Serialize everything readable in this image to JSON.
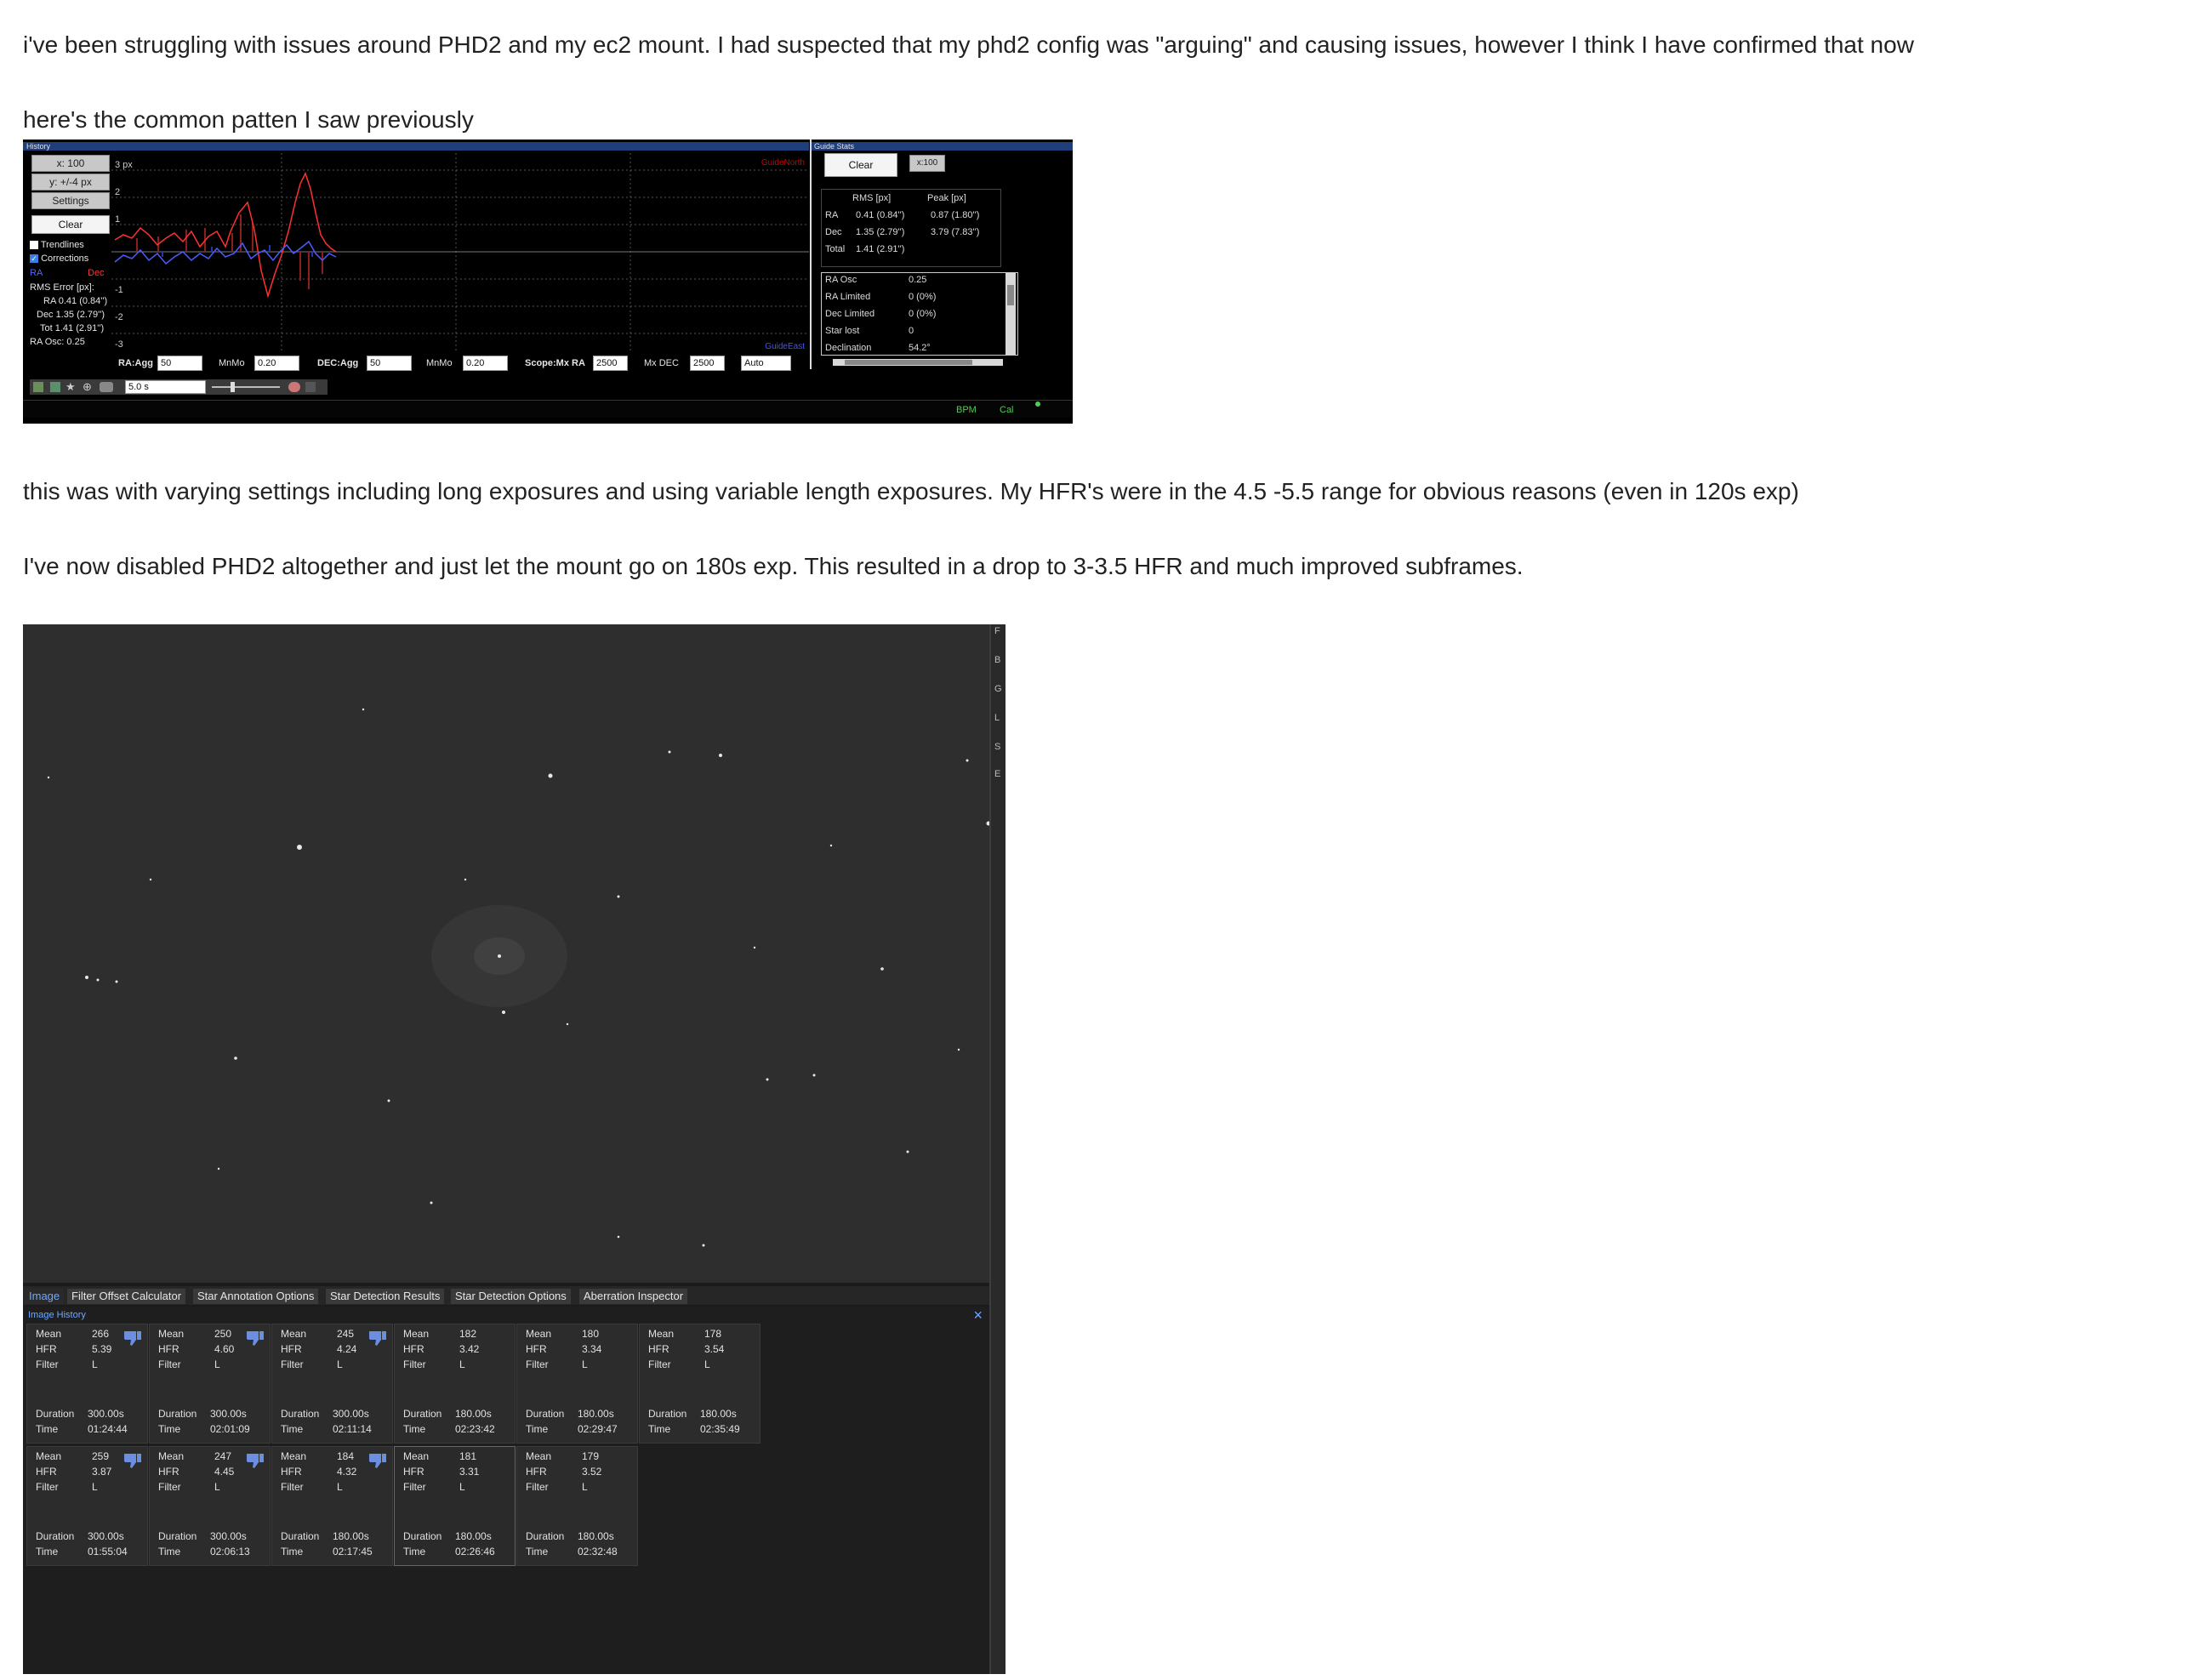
{
  "post": {
    "p1": "i've been struggling with issues around PHD2 and my ec2 mount. I had suspected that my phd2 config was \"arguing\" and causing issues, however I think I have confirmed that now",
    "p2": "here's the common patten I saw previously",
    "p3": "this was with varying settings including long exposures and using variable length exposures. My HFR's were in the 4.5 -5.5 range for obvious reasons (even in 120s exp)",
    "p4": "I've now disabled PHD2 altogether and just let the mount go on 180s exp. This resulted in a drop to 3-3.5 HFR and much improved subframes."
  },
  "phd2": {
    "history_title": "History",
    "x_scale": "x: 100",
    "y_scale": "y: +/-4 px",
    "settings": "Settings",
    "clear": "Clear",
    "trendlines": "Trendlines",
    "corrections": "Corrections",
    "legend_ra": "RA",
    "legend_dec": "Dec",
    "rms_title": "RMS Error [px]:",
    "rms_ra": "RA 0.41 (0.84'')",
    "rms_dec": "Dec 1.35 (2.79'')",
    "rms_tot": "Tot 1.41 (2.91'')",
    "ra_osc": "RA Osc: 0.25",
    "y_ticks": [
      "3 px",
      "2",
      "1",
      "-1",
      "-2",
      "-3"
    ],
    "guide_north": "GuideNorth",
    "guide_east": "GuideEast",
    "ra_agg_label": "RA:Agg",
    "ra_agg": "50",
    "mnmo_label": "MnMo",
    "ra_mnmo": "0.20",
    "dec_agg_label": "DEC:Agg",
    "dec_agg": "50",
    "dec_mnmo": "0.20",
    "scope_label": "Scope:Mx RA",
    "mx_ra": "2500",
    "mx_dec_label": "Mx DEC",
    "mx_dec": "2500",
    "dec_mode": "Auto",
    "exposure": "5.0 s",
    "status_bpm": "BPM",
    "status_cal": "Cal",
    "stats_title": "Guide Stats",
    "stats_clear": "Clear",
    "stats_scale": "x:100",
    "col_rms": "RMS [px]",
    "col_peak": "Peak [px]",
    "rows": [
      {
        "label": "RA",
        "rms": "0.41 (0.84'')",
        "peak": "0.87 (1.80'')"
      },
      {
        "label": "Dec",
        "rms": "1.35 (2.79'')",
        "peak": "3.79 (7.83'')"
      },
      {
        "label": "Total",
        "rms": "1.41 (2.91'')",
        "peak": ""
      }
    ],
    "extra": [
      {
        "label": "RA Osc",
        "value": "0.25"
      },
      {
        "label": "RA Limited",
        "value": "0 (0%)"
      },
      {
        "label": "Dec Limited",
        "value": "0 (0%)"
      },
      {
        "label": "Star lost",
        "value": "0"
      },
      {
        "label": "Declination",
        "value": "54.2°"
      }
    ]
  },
  "nina": {
    "tabs": [
      "Image",
      "Filter Offset Calculator",
      "Star Annotation Options",
      "Star Detection Results",
      "Star Detection Options",
      "Aberration Inspector"
    ],
    "history_title": "Image History",
    "right_letters": [
      "F",
      "B",
      "G",
      "L",
      "S",
      "E"
    ],
    "labels": {
      "mean": "Mean",
      "hfr": "HFR",
      "filter": "Filter",
      "duration": "Duration",
      "time": "Time"
    },
    "cards": [
      {
        "mean": "266",
        "hfr": "5.39",
        "filter": "L",
        "duration": "300.00s",
        "time": "01:24:44",
        "thumb": true
      },
      {
        "mean": "250",
        "hfr": "4.60",
        "filter": "L",
        "duration": "300.00s",
        "time": "02:01:09",
        "thumb": true
      },
      {
        "mean": "245",
        "hfr": "4.24",
        "filter": "L",
        "duration": "300.00s",
        "time": "02:11:14",
        "thumb": true
      },
      {
        "mean": "182",
        "hfr": "3.42",
        "filter": "L",
        "duration": "180.00s",
        "time": "02:23:42",
        "thumb": false
      },
      {
        "mean": "180",
        "hfr": "3.34",
        "filter": "L",
        "duration": "180.00s",
        "time": "02:29:47",
        "thumb": false
      },
      {
        "mean": "178",
        "hfr": "3.54",
        "filter": "L",
        "duration": "180.00s",
        "time": "02:35:49",
        "thumb": false
      },
      {
        "mean": "259",
        "hfr": "3.87",
        "filter": "L",
        "duration": "300.00s",
        "time": "01:55:04",
        "thumb": true
      },
      {
        "mean": "247",
        "hfr": "4.45",
        "filter": "L",
        "duration": "300.00s",
        "time": "02:06:13",
        "thumb": true
      },
      {
        "mean": "184",
        "hfr": "4.32",
        "filter": "L",
        "duration": "180.00s",
        "time": "02:17:45",
        "thumb": true
      },
      {
        "mean": "181",
        "hfr": "3.31",
        "filter": "L",
        "duration": "180.00s",
        "time": "02:26:46",
        "thumb": false,
        "selected": true
      },
      {
        "mean": "179",
        "hfr": "3.52",
        "filter": "L",
        "duration": "180.00s",
        "time": "02:32:48",
        "thumb": false
      }
    ]
  }
}
